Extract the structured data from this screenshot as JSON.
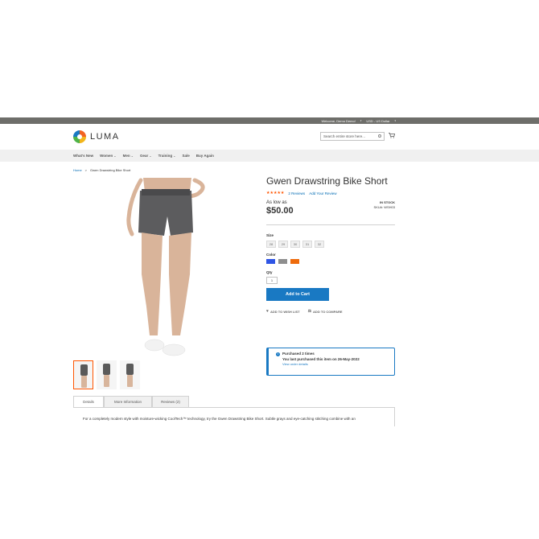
{
  "topbar": {
    "welcome": "Welcome, Demo Demo!",
    "currency": "USD - US Dollar"
  },
  "header": {
    "logo_text": "LUMA",
    "search_placeholder": "Search entire store here..."
  },
  "nav": {
    "items": [
      {
        "label": "What's New",
        "has_caret": false
      },
      {
        "label": "Women",
        "has_caret": true
      },
      {
        "label": "Men",
        "has_caret": true
      },
      {
        "label": "Gear",
        "has_caret": true
      },
      {
        "label": "Training",
        "has_caret": true
      },
      {
        "label": "Sale",
        "has_caret": false
      },
      {
        "label": "Buy Again",
        "has_caret": false
      }
    ]
  },
  "breadcrumb": {
    "home": "Home",
    "separator": ">",
    "current": "Gwen Drawstring Bike Short"
  },
  "product": {
    "title": "Gwen Drawstring Bike Short",
    "stars": "★★★★★",
    "rating_fraction": 0.8,
    "reviews_link": "2  Reviews",
    "add_review_link": "Add Your Review",
    "as_low_as": "As low as",
    "price": "$50.00",
    "stock": "IN STOCK",
    "sku": "SKU#:  WSH03",
    "size_label": "Size",
    "sizes": [
      "28",
      "29",
      "30",
      "31",
      "32"
    ],
    "color_label": "Color",
    "colors": [
      "#2f55e5",
      "#8e8e8e",
      "#ee6b0c"
    ],
    "qty_label": "Qty",
    "qty_value": "1",
    "add_to_cart": "Add to Cart",
    "wishlist": "ADD TO WISH LIST",
    "compare": "ADD TO COMPARE"
  },
  "notice": {
    "line1": "Purchased 2 times",
    "line2": "You last purchased this item on 26-May-2022",
    "link": "View order details"
  },
  "tabs": [
    {
      "label": "Details",
      "active": true
    },
    {
      "label": "More Information",
      "active": false
    },
    {
      "label": "Reviews (2)",
      "active": false
    }
  ],
  "description": "For a completely modern style with moisture-wicking CoolTech™ technology, try the Gwen Drawstring Bike Short. Subtle grays and eye-catching stitching combine with an",
  "colors": {
    "accent": "#1979c3",
    "link": "#006bb4",
    "star": "#ff5501",
    "topbar": "#6e6e6a"
  }
}
